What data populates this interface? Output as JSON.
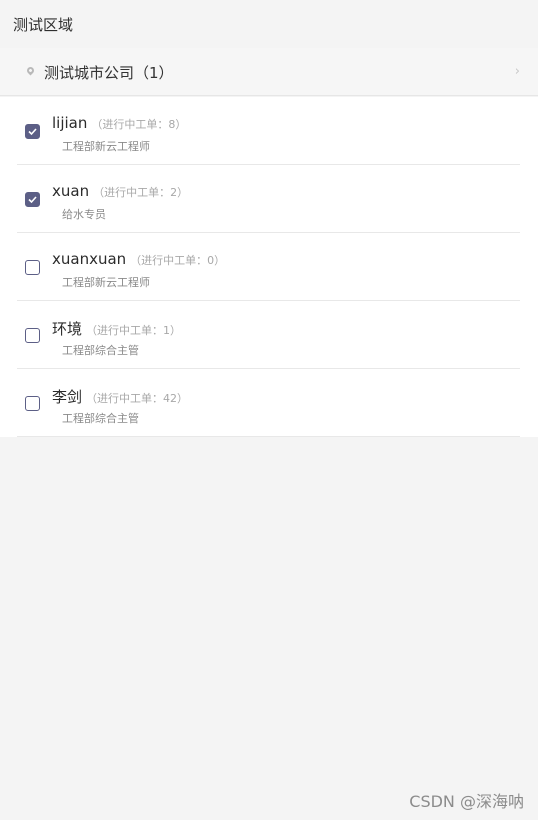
{
  "header": {
    "title": "测试区域"
  },
  "company": {
    "name": "测试城市公司（1）"
  },
  "people": [
    {
      "name": "lijian",
      "count": "（进行中工单：8）",
      "role": "工程部新云工程师",
      "checked": true
    },
    {
      "name": "xuan",
      "count": "（进行中工单：2）",
      "role": "给水专员",
      "checked": true
    },
    {
      "name": "xuanxuan",
      "count": "（进行中工单：0）",
      "role": "工程部新云工程师",
      "checked": false
    },
    {
      "name": "环境",
      "count": "（进行中工单：1）",
      "role": "工程部综合主管",
      "checked": false
    },
    {
      "name": "李剑",
      "count": "（进行中工单：42）",
      "role": "工程部综合主管",
      "checked": false
    }
  ],
  "watermark": "CSDN @深海呐",
  "colors": {
    "accent": "#5c5f86"
  }
}
